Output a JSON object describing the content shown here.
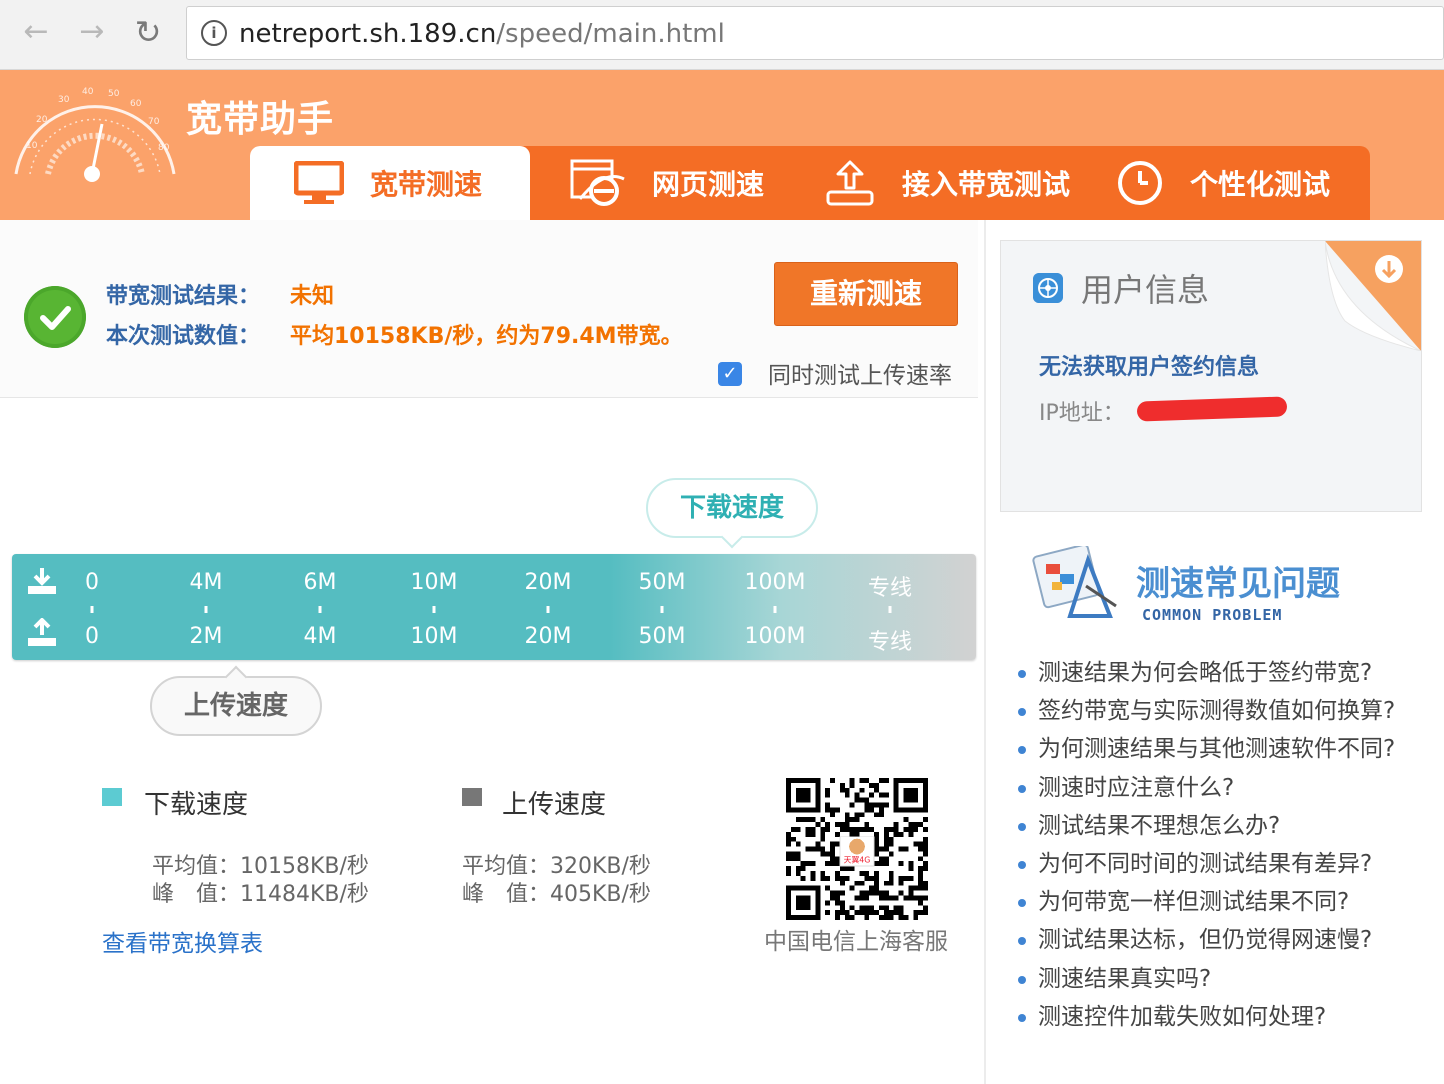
{
  "browser": {
    "url_host": "netreport.sh.189.cn",
    "url_path": "/speed/main.html"
  },
  "header": {
    "brand": "宽带助手",
    "tabs": [
      {
        "label": "宽带测速",
        "icon": "monitor-icon",
        "active": true
      },
      {
        "label": "网页测速",
        "icon": "browser-ie-icon",
        "active": false
      },
      {
        "label": "接入带宽测试",
        "icon": "upload-tray-icon",
        "active": false
      },
      {
        "label": "个性化测试",
        "icon": "clock-icon",
        "active": false
      }
    ]
  },
  "result": {
    "result_label": "带宽测试结果：",
    "result_value": "未知",
    "measure_label": "本次测试数值：",
    "measure_value": "平均10158KB/秒，约为79.4M带宽。",
    "retest_button": "重新测速",
    "upload_checkbox_label": "同时测试上传速率",
    "upload_checkbox_checked": true
  },
  "gauge": {
    "download_bubble": "下载速度",
    "upload_bubble": "上传速度",
    "download_ticks": [
      "0",
      "4M",
      "6M",
      "10M",
      "20M",
      "50M",
      "100M",
      "专线"
    ],
    "upload_ticks": [
      "0",
      "2M",
      "4M",
      "10M",
      "20M",
      "50M",
      "100M",
      "专线"
    ]
  },
  "stats": {
    "download": {
      "title": "下载速度",
      "avg": "平均值：10158KB/秒",
      "peak": "峰　值：11484KB/秒",
      "color": "#5ccbd2"
    },
    "upload": {
      "title": "上传速度",
      "avg": "平均值：320KB/秒",
      "peak": "峰　值：405KB/秒",
      "color": "#777777"
    },
    "conversion_link": "查看带宽换算表",
    "qr_caption": "中国电信上海客服",
    "qr_logo_text": "天翼4G"
  },
  "user_info": {
    "title": "用户信息",
    "message": "无法获取用户签约信息",
    "ip_label": "IP地址："
  },
  "faq": {
    "title": "测速常见问题",
    "subtitle": "COMMON PROBLEM",
    "items": [
      "测速结果为何会略低于签约带宽?",
      "签约带宽与实际测得数值如何换算?",
      "为何测速结果与其他测速软件不同?",
      "测速时应注意什么?",
      "测试结果不理想怎么办?",
      "为何不同时间的测试结果有差异?",
      "为何带宽一样但测试结果不同?",
      "测试结果达标，但仍觉得网速慢?",
      "测速结果真实吗?",
      "测速控件加载失败如何处理?"
    ]
  }
}
